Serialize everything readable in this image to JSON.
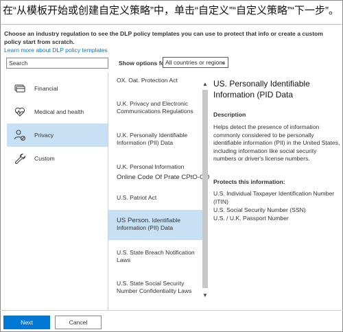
{
  "instruction": "在“从模板开始或创建自定义策略”中，单击“自定义”“自定义策略”“下一步”。",
  "header": {
    "description": "Choose an industry regulation to see the DLP policy templates you can use to protect that info or create a custom policy start from scratch.",
    "learn_link": "Learn more about DLP policy templates"
  },
  "search": {
    "placeholder": "Search",
    "value": "Search"
  },
  "filter": {
    "label": "Show options for",
    "selected": "All countries or regions"
  },
  "categories": [
    {
      "label": "Financial",
      "icon": "credit-card-icon"
    },
    {
      "label": "Medical and health",
      "icon": "heart-pulse-icon"
    },
    {
      "label": "Privacy",
      "icon": "person-shield-icon",
      "selected": true
    },
    {
      "label": "Custom",
      "icon": "wrench-icon"
    }
  ],
  "templates": [
    "OX. Oat. Protection Act",
    "U.K. Privacy and Electronic Communications Regulations",
    "U.K. Personally Identifiable Information (PII) Data",
    "U.K. Personal Information Online Code Of Prate CPtO-CO",
    "U.S. Patriot Act",
    "US Person. Identifiable Information (PII) Data",
    "U.S. State Breach Notification Laws",
    "U.S. State Social Security Number Confidentiality Laws"
  ],
  "template_lines": {
    "t0": "OX. Oat. Protection Act",
    "t1a": "U.K. Privacy and Electronic",
    "t1b": "Communications Regulations",
    "t2a": "U.K. Personally Identifiable",
    "t2b": "Information (PII) Data",
    "t3a": "U.K. Personal Information",
    "t3b": "Online Code Of Prate CPtO-CO",
    "t4": "U.S. Patriot Act",
    "t5a": "US Person.",
    "t5b": "Identifiable",
    "t5c": "Information (PII) Data",
    "t6a": "U.S. State Breach Notification",
    "t6b": "Laws",
    "t7a": "U.S. State Social Security",
    "t7b": "Number Confidentiality Laws"
  },
  "detail": {
    "title": "US. Personally Identifiable Information (PID Data",
    "description_heading": "Description",
    "description": "Helps detect the presence of information commonly considered to be personally identifiable information (PII) in the United States, including information like social security numbers or driver's license numbers.",
    "protects_heading": "Protects this information:",
    "protects": [
      "U.S. Individual Taxpayer Identification Number (ITIN)",
      "U.S. Social Security Number (SSN)",
      "U.S. / U.K. Passport Number"
    ]
  },
  "buttons": {
    "next": "Next",
    "cancel": "Cancel"
  },
  "colors": {
    "accent": "#0078d4",
    "selected": "#c7e0f4"
  }
}
